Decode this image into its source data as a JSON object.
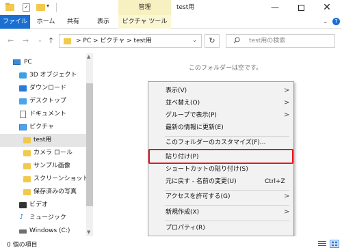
{
  "title_bar": {
    "manage_tab": "管理",
    "window_title": "test用",
    "minimize": "—",
    "close": "✕"
  },
  "ribbon": {
    "tabs": [
      "ファイル",
      "ホーム",
      "共有",
      "表示",
      "ピクチャ ツール"
    ],
    "collapse": "⌄",
    "help": "?"
  },
  "nav": {
    "back": "←",
    "forward": "→",
    "recent": "⌄",
    "up": "↑",
    "address_crumbs": ">  PC  >  ピクチャ  >  test用",
    "address_dropdown": "⌄",
    "refresh": "↻",
    "search_placeholder": "test用の検索"
  },
  "sidebar": {
    "items": [
      {
        "label": "PC",
        "icon": "computer-icon"
      },
      {
        "label": "3D オブジェクト",
        "icon": "3d-objects-icon"
      },
      {
        "label": "ダウンロード",
        "icon": "download-icon"
      },
      {
        "label": "デスクトップ",
        "icon": "desktop-icon"
      },
      {
        "label": "ドキュメント",
        "icon": "document-icon"
      },
      {
        "label": "ピクチャ",
        "icon": "pictures-icon"
      },
      {
        "label": "test用",
        "icon": "folder-icon",
        "selected": true
      },
      {
        "label": "カメラ ロール",
        "icon": "folder-icon"
      },
      {
        "label": "サンプル画像",
        "icon": "folder-icon"
      },
      {
        "label": "スクリーンショット",
        "icon": "folder-icon"
      },
      {
        "label": "保存済みの写真",
        "icon": "folder-icon"
      },
      {
        "label": "ビデオ",
        "icon": "video-icon"
      },
      {
        "label": "ミュージック",
        "icon": "music-icon"
      },
      {
        "label": "Windows (C:)",
        "icon": "drive-icon"
      }
    ]
  },
  "main": {
    "empty_message": "このフォルダーは空です。"
  },
  "context_menu": {
    "items": [
      {
        "label": "表示(V)",
        "arrow": ">"
      },
      {
        "label": "並べ替え(O)",
        "arrow": ">"
      },
      {
        "label": "グループで表示(P)",
        "arrow": ">"
      },
      {
        "label": "最新の情報に更新(E)"
      },
      {
        "label": "このフォルダーのカスタマイズ(F)..."
      },
      {
        "label": "貼り付け(P)"
      },
      {
        "label": "ショートカットの貼り付け(S)"
      },
      {
        "label": "元に戻す - 名前の変更(U)",
        "shortcut": "Ctrl+Z"
      },
      {
        "label": "アクセスを許可する(G)",
        "arrow": ">"
      },
      {
        "label": "新規作成(X)",
        "arrow": ">"
      },
      {
        "label": "プロパティ(R)"
      }
    ],
    "highlight_color": "#e8151b"
  },
  "status_bar": {
    "item_count": "0 個の項目"
  },
  "colors": {
    "accent": "#1a6fd1",
    "manage_tab": "#f7f1c1",
    "folder": "#f2c94c"
  }
}
